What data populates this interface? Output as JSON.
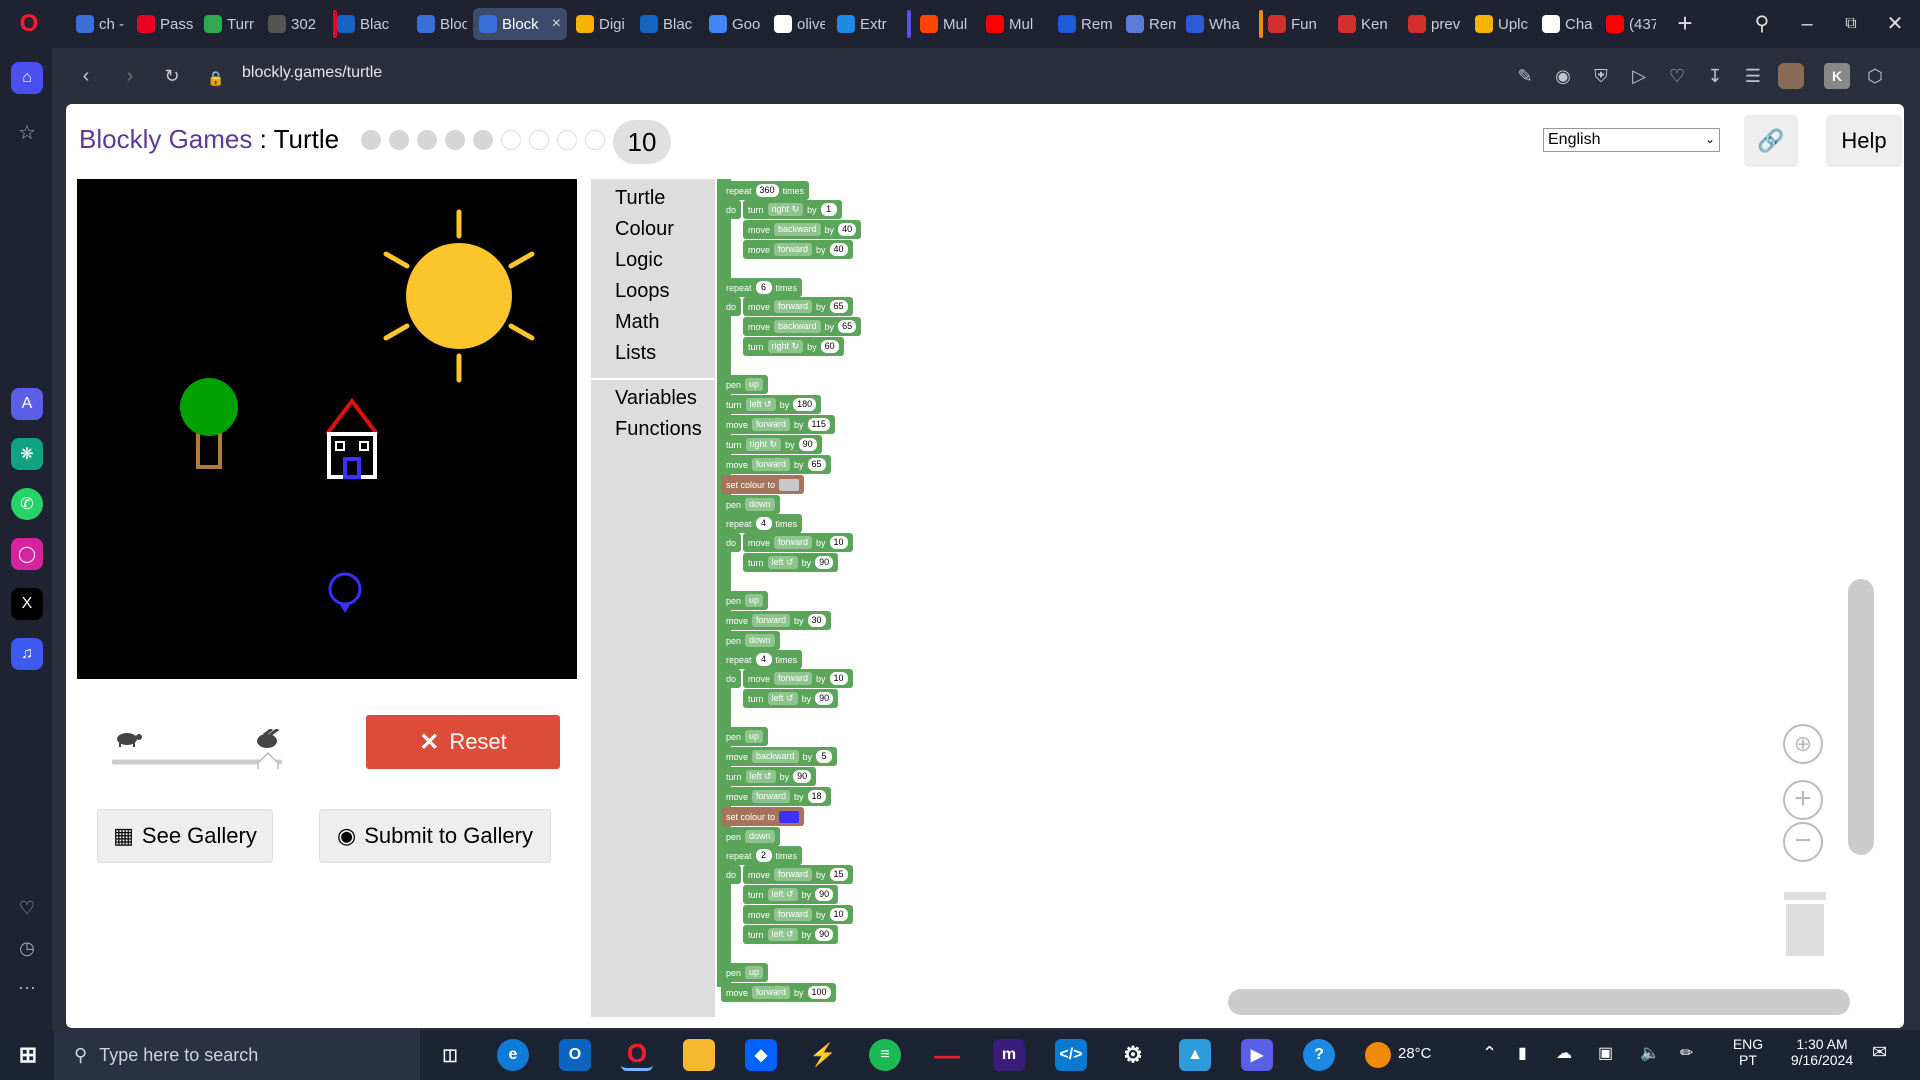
{
  "browser": {
    "tabs": [
      {
        "label": "ch -",
        "color": "#3b6fd8"
      },
      {
        "label": "Pass",
        "color": "#e60023"
      },
      {
        "label": "Turr",
        "color": "#2fa84f"
      },
      {
        "label": "302",
        "color": "#555555"
      },
      {
        "label": "Blac",
        "color": "#1565c0"
      },
      {
        "label": "Bloc",
        "color": "#3b6fd8"
      },
      {
        "label": "Block",
        "color": "#3b6fd8"
      },
      {
        "label": "Digi",
        "color": "#f4b400"
      },
      {
        "label": "Blac",
        "color": "#1565c0"
      },
      {
        "label": "Goo",
        "color": "#4285f4"
      },
      {
        "label": "olive",
        "color": "#ffffff"
      },
      {
        "label": "Extr",
        "color": "#1e88e5"
      },
      {
        "label": "Mul",
        "color": "#ff4500"
      },
      {
        "label": "Mul",
        "color": "#ff0000"
      },
      {
        "label": "Rem",
        "color": "#1e5bd8"
      },
      {
        "label": "Rem",
        "color": "#5b7bd8"
      },
      {
        "label": "Wha",
        "color": "#2d5bd8"
      },
      {
        "label": "Fun",
        "color": "#d32f2f"
      },
      {
        "label": "Ken",
        "color": "#d32f2f"
      },
      {
        "label": "prev",
        "color": "#d32f2f"
      },
      {
        "label": "Uplc",
        "color": "#f4b400"
      },
      {
        "label": "Cha",
        "color": "#ffffff"
      },
      {
        "label": "(437",
        "color": "#ff0000"
      }
    ],
    "url": "blockly.games/turtle"
  },
  "game": {
    "title_game": "Blockly Games",
    "title_sep": " : ",
    "title_page": "Turtle",
    "level": "10",
    "language": "English",
    "help": "Help",
    "reset": "Reset",
    "see_gallery": "See Gallery",
    "submit_gallery": "Submit to Gallery",
    "accent_red": "#dd4b39",
    "categories": [
      "Turtle",
      "Colour",
      "Logic",
      "Loops",
      "Math",
      "Lists",
      "Variables",
      "Functions"
    ]
  },
  "blocks": {
    "repeat": "repeat",
    "times": "times",
    "do": "do",
    "turn": "turn",
    "move": "move",
    "by": "by",
    "pen": "pen",
    "set_colour": "set colour to",
    "right": "right ↻",
    "left": "left ↺",
    "forward": "forward",
    "backward": "backward",
    "up": "up",
    "down": "down",
    "n360": "360",
    "n1": "1",
    "n40a": "40",
    "n40b": "40",
    "n6": "6",
    "n65a": "65",
    "n65b": "65",
    "n60": "60",
    "n180": "180",
    "n115": "115",
    "n90a": "90",
    "n65c": "65",
    "n4a": "4",
    "n10a": "10",
    "n90b": "90",
    "n30": "30",
    "n4b": "4",
    "n10b": "10",
    "n90c": "90",
    "n5": "5",
    "n90d": "90",
    "n18": "18",
    "n2": "2",
    "n15": "15",
    "n90e": "90",
    "n10c": "10",
    "n90f": "90",
    "n100": "100"
  },
  "taskbar": {
    "search_placeholder": "Type here to search",
    "weather": "28°C",
    "lang_top": "ENG",
    "lang_bottom": "PT",
    "time": "1:30 AM",
    "date": "9/16/2024"
  }
}
